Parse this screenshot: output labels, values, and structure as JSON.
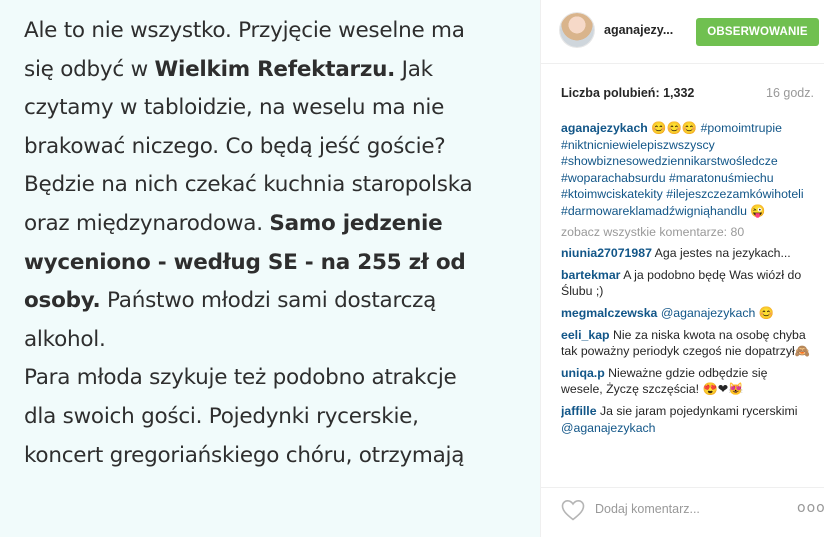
{
  "image": {
    "paragraph1_lines": [
      "Ale to nie wszystko. Przyjęcie weselne ma",
      "się odbyć w ",
      "Wielkim Refektarzu.",
      " Jak",
      "czytamy w tabloidzie, na weselu ma nie",
      "brakować niczego. Co będą jeść goście?",
      "Będzie na nich czekać kuchnia staropolska",
      "oraz międzynarodowa. ",
      "Samo jedzenie",
      "wyceniono - według SE - na 255 zł od",
      "osoby.",
      " Państwo młodzi sami dostarczą",
      "alkohol."
    ],
    "paragraph2_lines": [
      "Para młoda szykuje też podobno atrakcje",
      "dla swoich gości. Pojedynki rycerskie,",
      "koncert gregoriańskiego chóru, otrzymają"
    ]
  },
  "header": {
    "username": "aganajezy...",
    "follow_label": "OBSERWOWANIE"
  },
  "stats": {
    "likes_label": "Liczba polubień:",
    "likes_count": "1,332",
    "time_ago": "16 godz."
  },
  "caption": {
    "author": "aganajezykach",
    "emoji": "😊😊😊",
    "hashtags": [
      "#pomoimtrupie",
      "#niktnicniewielepiszwszyscy",
      "#showbiznesowedziennikarstwośledcze",
      "#woparachabsurdu",
      "#maratonuśmiechu",
      "#ktoimwciskatekity",
      "#ilejeszczezamkówihoteli",
      "#darmowareklamadźwigniąhandlu"
    ],
    "tail_emoji": "😜"
  },
  "view_all_label": "zobacz wszystkie komentarze: 80",
  "comments": [
    {
      "author": "niunia27071987",
      "text": "Aga jestes na jezykach..."
    },
    {
      "author": "bartekmar",
      "text": "A ja podobno będę Was wiózł do Ślubu ;)"
    },
    {
      "author": "megmalczewska",
      "text": "",
      "mention": "@aganajezykach",
      "after": " 😊"
    },
    {
      "author": "eeli_kap",
      "text": "Nie za niska kwota na osobę chyba tak poważny periodyk czegoś nie dopatrzył🙈"
    },
    {
      "author": "uniqa.p",
      "text": "Nieważne gdzie odbędzie się wesele, Życzę szczęścia! 😍❤😻"
    },
    {
      "author": "jaffille",
      "text": "Ja sie jaram pojedynkami rycerskimi ",
      "mention": "@aganajezykach",
      "after": ""
    }
  ],
  "footer": {
    "comment_placeholder": "Dodaj komentarz...",
    "more_glyph": "ooo"
  },
  "colors": {
    "follow_button": "#70c050",
    "link": "#125688",
    "image_background": "#f1fbfb"
  },
  "icons": [
    "heart-icon",
    "more-options-icon"
  ]
}
